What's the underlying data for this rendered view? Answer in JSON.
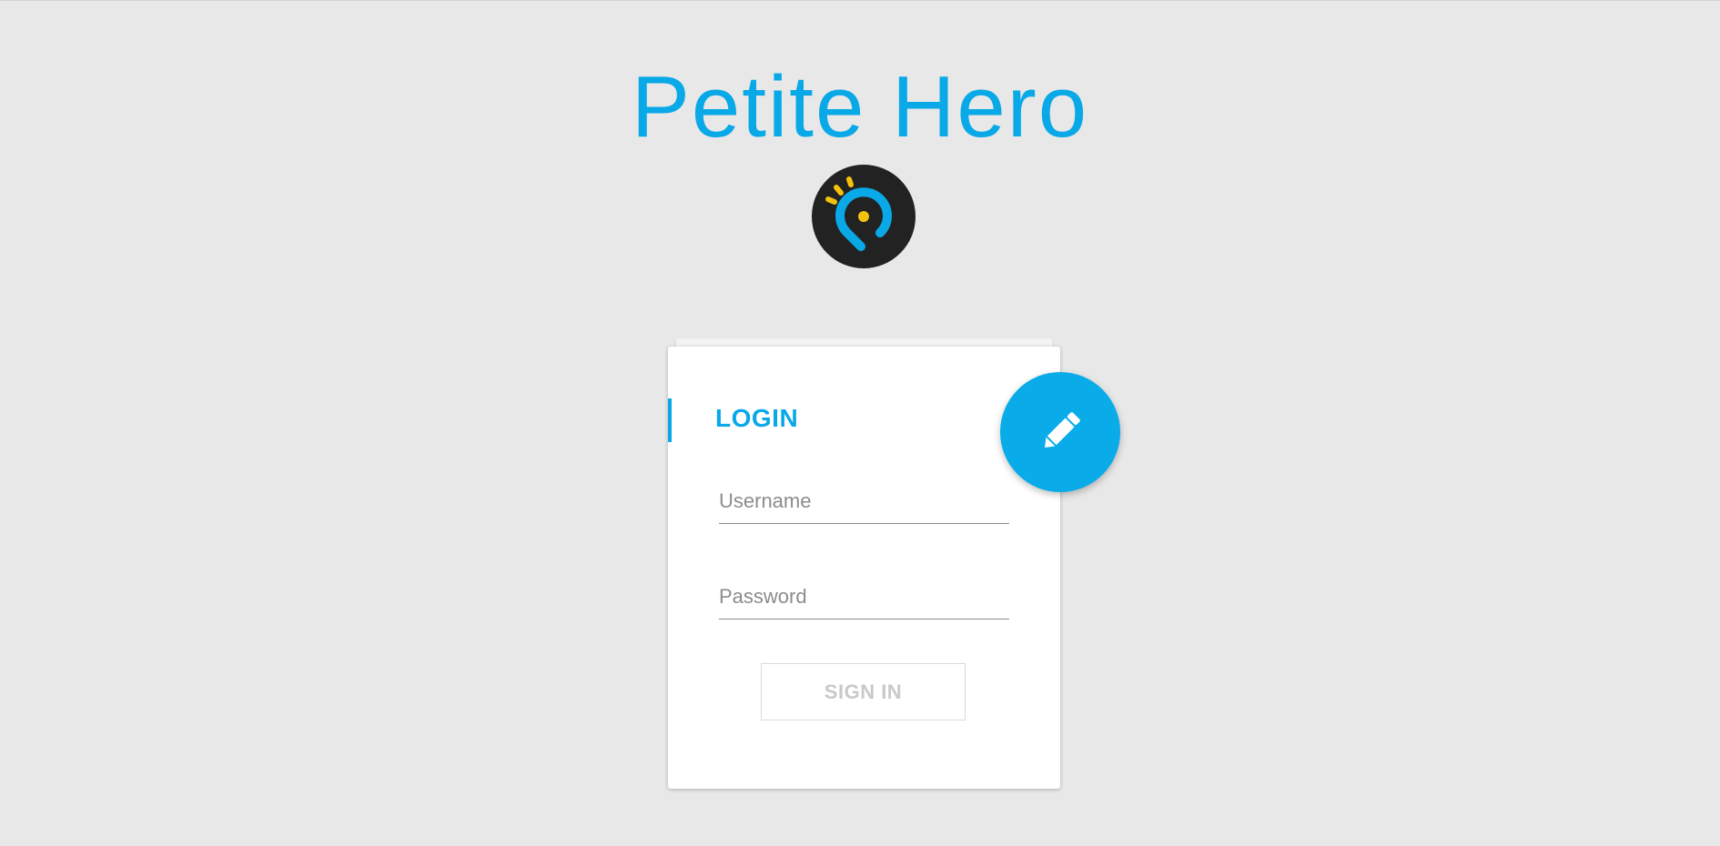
{
  "app": {
    "title": "Petite Hero"
  },
  "colors": {
    "accent": "#09a9e8",
    "logo_background": "#222222",
    "logo_rays": "#f4c20d",
    "page_background": "#e8e8e8"
  },
  "logo": {
    "icon": "location-pin-logo"
  },
  "login": {
    "title": "LOGIN",
    "username_placeholder": "Username",
    "username_value": "",
    "password_placeholder": "Password",
    "password_value": "",
    "signin_label": "SIGN IN"
  },
  "fab": {
    "icon": "pencil-icon"
  }
}
